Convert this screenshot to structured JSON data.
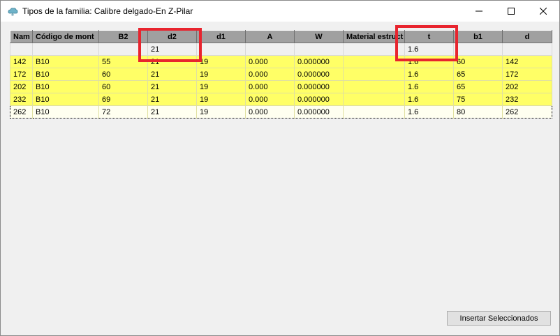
{
  "window": {
    "title": "Tipos de la familia: Calibre delgado-En Z-Pilar",
    "icon": "cloud-icon"
  },
  "grid": {
    "columns": [
      "Nam",
      "Código de mont",
      "B2",
      "d2",
      "d1",
      "A",
      "W",
      "Material estruct",
      "t",
      "b1",
      "d"
    ],
    "filter_row": [
      "",
      "",
      "",
      "21",
      "",
      "",
      "",
      "",
      "1.6",
      "",
      ""
    ],
    "rows": [
      [
        "142",
        "B10",
        "55",
        "21",
        "19",
        "0.000",
        "0.000000",
        "",
        "1.6",
        "60",
        "142"
      ],
      [
        "172",
        "B10",
        "60",
        "21",
        "19",
        "0.000",
        "0.000000",
        "",
        "1.6",
        "65",
        "172"
      ],
      [
        "202",
        "B10",
        "60",
        "21",
        "19",
        "0.000",
        "0.000000",
        "",
        "1.6",
        "65",
        "202"
      ],
      [
        "232",
        "B10",
        "69",
        "21",
        "19",
        "0.000",
        "0.000000",
        "",
        "1.6",
        "75",
        "232"
      ],
      [
        "262",
        "B10",
        "72",
        "21",
        "19",
        "0.000",
        "0.000000",
        "",
        "1.6",
        "80",
        "262"
      ]
    ],
    "row_color": "#ffff66",
    "highlight_color": "#e8242e"
  },
  "footer": {
    "insert_label": "Insertar Seleccionados"
  }
}
